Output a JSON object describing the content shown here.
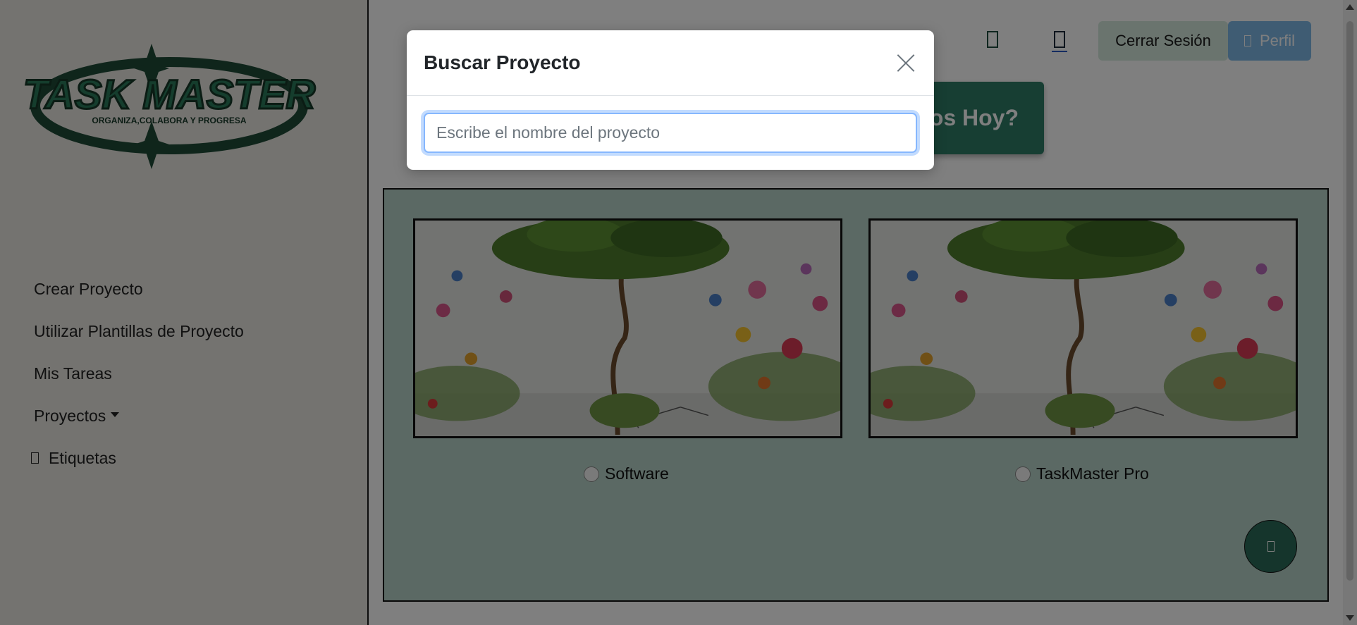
{
  "sidebar": {
    "logo": {
      "title": "TASK MASTER",
      "tagline": "ORGANIZA,COLABORA Y PROGRESA"
    },
    "items": [
      {
        "label": "Crear Proyecto"
      },
      {
        "label": "Utilizar Plantillas de Proyecto"
      },
      {
        "label": "Mis Tareas"
      },
      {
        "label": "Proyectos"
      },
      {
        "label": "Etiquetas"
      }
    ]
  },
  "header": {
    "logout_label": "Cerrar Sesión",
    "profile_label": "Perfil",
    "welcome_text": "¿Qué Hacemos Hoy?"
  },
  "projects": [
    {
      "name": "Software"
    },
    {
      "name": "TaskMaster Pro"
    }
  ],
  "modal": {
    "title": "Buscar Proyecto",
    "search_placeholder": "Escribe el nombre del proyecto",
    "search_value": ""
  },
  "colors": {
    "brand_green": "#2e7c67",
    "board_bg": "#b7d3c8",
    "sidebar_bg": "#e8e6e1",
    "logo_green": "#1f4a37",
    "profile_blue": "#7fb8e6"
  }
}
